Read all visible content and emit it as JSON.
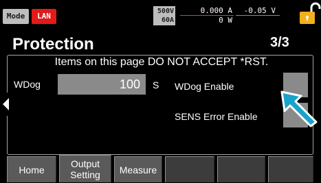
{
  "status_bar": {
    "mode_label": "Mode",
    "lan_label": "LAN",
    "rating_voltage": "500V",
    "rating_current": "60A",
    "current_reading": "0.000 A",
    "power_reading": "0 W",
    "voltage_reading": "-0.05 V",
    "colors": {
      "lan": "#e21a1a",
      "current_line": "#e03c3c",
      "voltage_line": "#3fbf50",
      "lock": "#f2b01e"
    },
    "lock_icon": "lock-icon"
  },
  "header": {
    "title": "Protection",
    "page_number": "3/3"
  },
  "panel": {
    "notice": "Items on this page DO NOT ACCEPT *RST.",
    "wdog": {
      "label": "WDog",
      "value": "100",
      "unit": "S"
    },
    "wdog_enable_label": "WDog Enable",
    "sens_error_enable_label": "SENS Error Enable"
  },
  "pointer": {
    "icon": "arrow-pointer-icon",
    "color": "#1aa3c8"
  },
  "tabs": [
    {
      "line1": "Home",
      "line2": ""
    },
    {
      "line1": "Output",
      "line2": "Setting"
    },
    {
      "line1": "Measure",
      "line2": ""
    }
  ]
}
